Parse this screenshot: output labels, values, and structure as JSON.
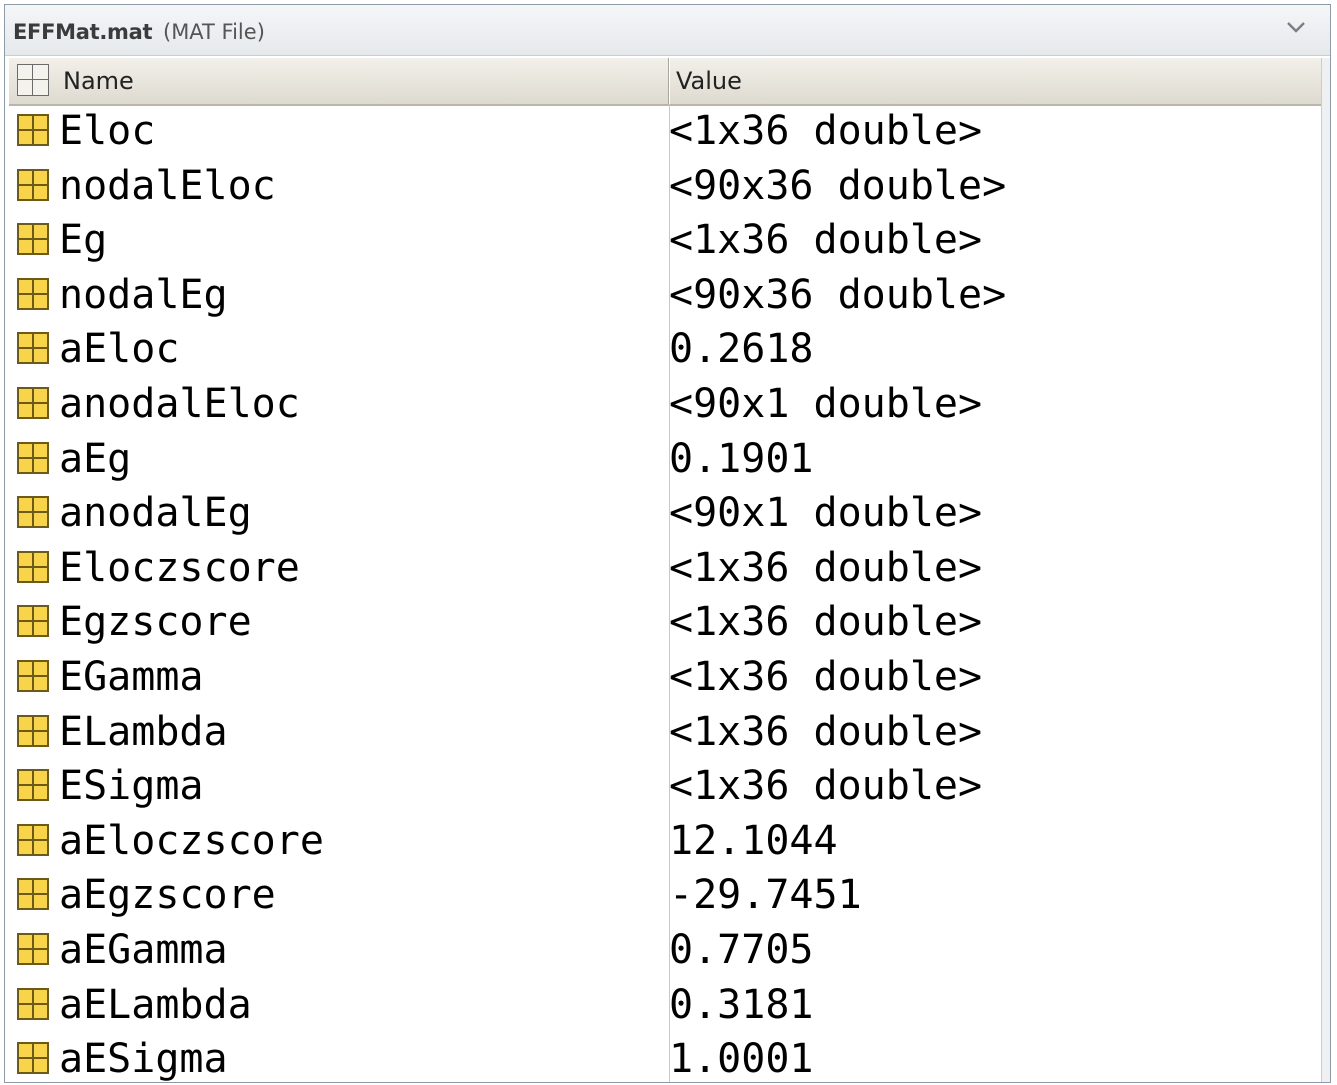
{
  "panel": {
    "file_name": "EFFMat.mat",
    "file_type": "(MAT File)",
    "collapse_icon": "chevron-down-icon"
  },
  "table": {
    "columns": [
      "Name",
      "Value"
    ],
    "corner_icon": "grid-icon",
    "row_icon": "matrix-variable-icon",
    "accent_color": "#f7d44a",
    "rows": [
      {
        "name": "Eloc",
        "value": "<1x36 double>"
      },
      {
        "name": "nodalEloc",
        "value": "<90x36 double>"
      },
      {
        "name": "Eg",
        "value": "<1x36 double>"
      },
      {
        "name": "nodalEg",
        "value": "<90x36 double>"
      },
      {
        "name": "aEloc",
        "value": "0.2618"
      },
      {
        "name": "anodalEloc",
        "value": "<90x1 double>"
      },
      {
        "name": "aEg",
        "value": "0.1901"
      },
      {
        "name": "anodalEg",
        "value": "<90x1 double>"
      },
      {
        "name": "Eloczscore",
        "value": "<1x36 double>"
      },
      {
        "name": "Egzscore",
        "value": "<1x36 double>"
      },
      {
        "name": "EGamma",
        "value": "<1x36 double>"
      },
      {
        "name": "ELambda",
        "value": "<1x36 double>"
      },
      {
        "name": "ESigma",
        "value": "<1x36 double>"
      },
      {
        "name": "aEloczscore",
        "value": "12.1044"
      },
      {
        "name": "aEgzscore",
        "value": "-29.7451"
      },
      {
        "name": "aEGamma",
        "value": "0.7705"
      },
      {
        "name": "aELambda",
        "value": "0.3181"
      },
      {
        "name": "aESigma",
        "value": "1.0001"
      }
    ]
  }
}
